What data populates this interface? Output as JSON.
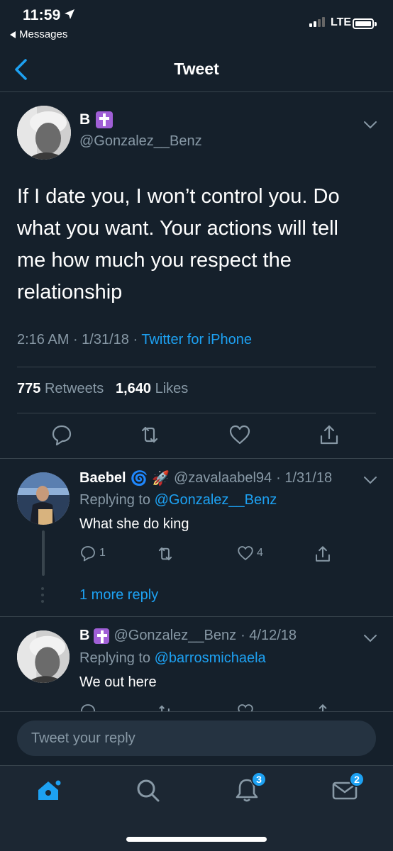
{
  "status_bar": {
    "time": "11:59",
    "back_app": "Messages",
    "network": "LTE"
  },
  "nav": {
    "title": "Tweet"
  },
  "main_tweet": {
    "display_name": "B",
    "handle": "@Gonzalez__Benz",
    "text": "If I date you, I won’t control you. Do what you want. Your actions will tell me how much you respect the relationship",
    "time": "2:16 AM",
    "date": "1/31/18",
    "client": "Twitter for iPhone",
    "retweets_count": "775",
    "retweets_label": "Retweets",
    "likes_count": "1,640",
    "likes_label": "Likes"
  },
  "replies": [
    {
      "display_name": "Baebel",
      "emoji": "🌀 🚀",
      "handle": "@zavalaabel94",
      "date": "· 1/31/18",
      "replying_label": "Replying to",
      "replying_to": "@Gonzalez__Benz",
      "text": "What she do king",
      "reply_count": "1",
      "like_count": "4",
      "more_replies": "1 more reply"
    },
    {
      "display_name": "B",
      "handle": "@Gonzalez__Benz",
      "date": "· 4/12/18",
      "replying_label": "Replying to",
      "replying_to": "@barrosmichaela",
      "text": "We out here"
    }
  ],
  "composer": {
    "placeholder": "Tweet your reply"
  },
  "tab_bar": {
    "notifications_badge": "3",
    "messages_badge": "2"
  },
  "colors": {
    "background": "#15202b",
    "accent": "#1da1f2",
    "secondary_text": "#8899a6",
    "divider": "#38444d"
  }
}
